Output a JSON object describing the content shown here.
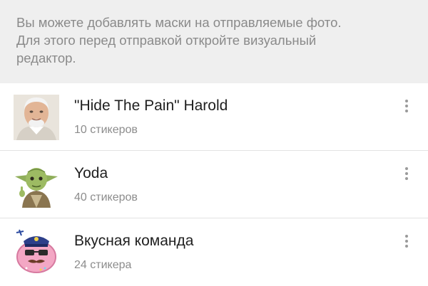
{
  "info": {
    "text": "Вы можете добавлять маски на отправляемые фото. Для этого перед отправкой откройте визуальный редактор."
  },
  "sticker_packs": [
    {
      "title": "\"Hide The Pain\" Harold",
      "count": "10 стикеров",
      "icon": "harold-face"
    },
    {
      "title": "Yoda",
      "count": "40 стикеров",
      "icon": "yoda"
    },
    {
      "title": "Вкусная команда",
      "count": "24 стикера",
      "icon": "donut-police"
    }
  ],
  "colors": {
    "info_background": "#efefef",
    "info_text": "#8a8a8a",
    "title_text": "#1f1f1f",
    "secondary_text": "#8c8c8c",
    "menu_dots": "#9a9a9a"
  }
}
